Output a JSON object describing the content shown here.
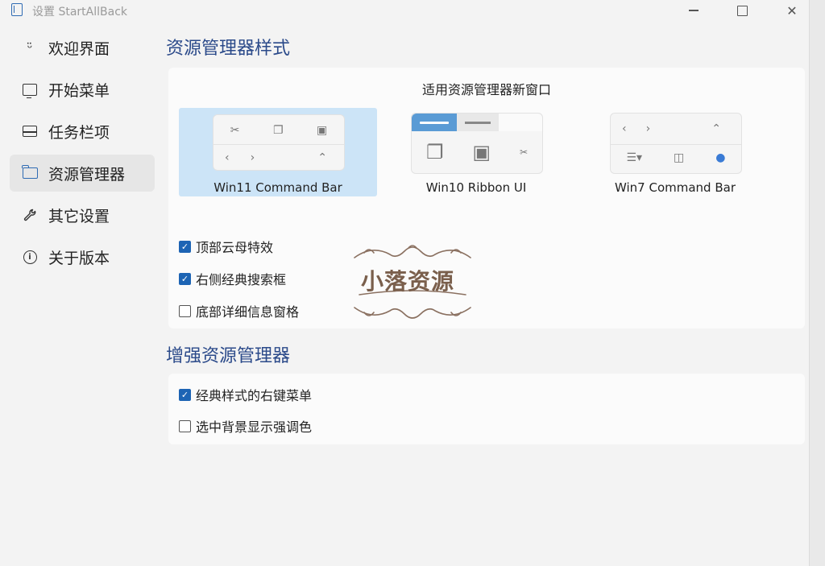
{
  "titlebar": {
    "title": "设置 StartAllBack"
  },
  "sidebar": {
    "items": [
      {
        "label": "欢迎界面",
        "icon": "smile-icon"
      },
      {
        "label": "开始菜单",
        "icon": "monitor-icon"
      },
      {
        "label": "任务栏项",
        "icon": "taskbar-icon"
      },
      {
        "label": "资源管理器",
        "icon": "folder-icon"
      },
      {
        "label": "其它设置",
        "icon": "wrench-icon"
      },
      {
        "label": "关于版本",
        "icon": "info-icon"
      }
    ],
    "active": "资源管理器"
  },
  "explorer_style": {
    "title": "资源管理器样式",
    "caption": "适用资源管理器新窗口",
    "options": [
      {
        "label": "Win11 Command Bar",
        "selected": true
      },
      {
        "label": "Win10 Ribbon UI",
        "selected": false
      },
      {
        "label": "Win7 Command Bar",
        "selected": false
      }
    ],
    "checks": [
      {
        "label": "顶部云母特效",
        "checked": true
      },
      {
        "label": "右侧经典搜索框",
        "checked": true
      },
      {
        "label": "底部详细信息窗格",
        "checked": false
      }
    ]
  },
  "enhance": {
    "title": "增强资源管理器",
    "checks": [
      {
        "label": "经典样式的右键菜单",
        "checked": true
      },
      {
        "label": "选中背景显示强调色",
        "checked": false
      }
    ]
  },
  "watermark": {
    "text": "小落资源"
  },
  "colors": {
    "accent": "#1d64b4",
    "selected_bg": "#cce4f7",
    "section_title": "#2b4a8a"
  }
}
